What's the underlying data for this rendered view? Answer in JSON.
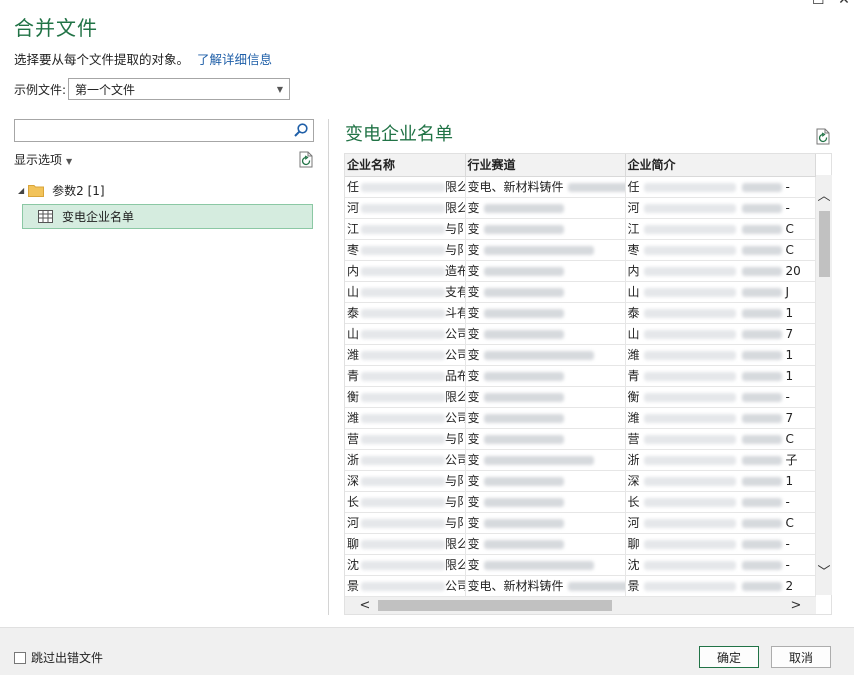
{
  "dialog": {
    "title": "合并文件",
    "subtitle": "选择要从每个文件提取的对象。",
    "learn_more": "了解详细信息"
  },
  "example_file": {
    "label": "示例文件:",
    "selected": "第一个文件"
  },
  "navigator": {
    "search_placeholder": "",
    "display_options": "显示选项",
    "folder": "参数2 [1]",
    "item": "变电企业名单"
  },
  "preview": {
    "title": "变电企业名单",
    "columns": [
      "企业名称",
      "行业赛道",
      "企业简介"
    ],
    "rows": [
      [
        "任",
        "限么",
        "变电、新材料铸件",
        "任",
        "-"
      ],
      [
        "河",
        "限么",
        "变",
        "河",
        "-"
      ],
      [
        "江",
        "与阝",
        "变",
        "江",
        "C"
      ],
      [
        "枣",
        "与阝",
        "变",
        "枣",
        "C"
      ],
      [
        "内",
        "造布",
        "变",
        "内",
        "20"
      ],
      [
        "山",
        "支有",
        "变",
        "山",
        "J"
      ],
      [
        "泰",
        "斗有",
        "变",
        "泰",
        "1"
      ],
      [
        "山",
        "公司",
        "变",
        "山",
        "7"
      ],
      [
        "潍",
        "公司",
        "变",
        "潍",
        "1"
      ],
      [
        "青",
        "品布",
        "变",
        "青",
        "1"
      ],
      [
        "衡",
        "限么",
        "变",
        "衡",
        "-"
      ],
      [
        "潍",
        "公司",
        "变",
        "潍",
        "7"
      ],
      [
        "营",
        "与阝",
        "变",
        "营",
        "C"
      ],
      [
        "浙",
        "公司",
        "变",
        "浙",
        "子"
      ],
      [
        "深",
        "与阝",
        "变",
        "深",
        "1"
      ],
      [
        "长",
        "与阝",
        "变",
        "长",
        "-"
      ],
      [
        "河",
        "与阝",
        "变",
        "河",
        "C"
      ],
      [
        "聊",
        "限么",
        "变",
        "聊",
        "-"
      ],
      [
        "沈",
        "限么",
        "变",
        "沈",
        "-"
      ],
      [
        "景",
        "公司",
        "变电、新材料铸件",
        "景",
        "2"
      ]
    ]
  },
  "footer": {
    "skip_errors": "跳过出错文件",
    "ok": "确定",
    "cancel": "取消"
  },
  "colors": {
    "accent": "#217346",
    "link": "#1f5fa8",
    "selection_bg": "#d5ecdf",
    "selection_border": "#8bc8a4"
  }
}
